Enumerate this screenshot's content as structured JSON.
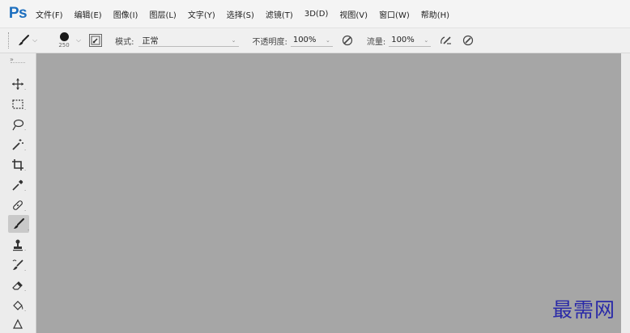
{
  "app": {
    "logo": "Ps",
    "brand_color": "#1d6fbf"
  },
  "menu": [
    {
      "label": "文件(F)"
    },
    {
      "label": "编辑(E)"
    },
    {
      "label": "图像(I)"
    },
    {
      "label": "图层(L)"
    },
    {
      "label": "文字(Y)"
    },
    {
      "label": "选择(S)"
    },
    {
      "label": "滤镜(T)"
    },
    {
      "label": "3D(D)"
    },
    {
      "label": "视图(V)"
    },
    {
      "label": "窗口(W)"
    },
    {
      "label": "帮助(H)"
    }
  ],
  "options": {
    "tool_preset_icon": "brush-icon",
    "brush_size": "250",
    "mode_label": "模式:",
    "mode_value": "正常",
    "opacity_label": "不透明度:",
    "opacity_value": "100%",
    "flow_label": "流量:",
    "flow_value": "100%"
  },
  "toolbar": {
    "tools": [
      {
        "name": "move-tool",
        "icon": "move-icon"
      },
      {
        "name": "marquee-tool",
        "icon": "rectangle-marquee-icon"
      },
      {
        "name": "lasso-tool",
        "icon": "lasso-icon"
      },
      {
        "name": "magic-wand-tool",
        "icon": "magic-wand-icon"
      },
      {
        "name": "crop-tool",
        "icon": "crop-icon"
      },
      {
        "name": "eyedropper-tool",
        "icon": "eyedropper-icon"
      },
      {
        "name": "healing-brush-tool",
        "icon": "bandage-icon"
      },
      {
        "name": "brush-tool",
        "icon": "brush-icon",
        "active": true
      },
      {
        "name": "clone-stamp-tool",
        "icon": "stamp-icon"
      },
      {
        "name": "history-brush-tool",
        "icon": "history-brush-icon"
      },
      {
        "name": "eraser-tool",
        "icon": "eraser-icon"
      },
      {
        "name": "paint-bucket-tool",
        "icon": "bucket-icon"
      },
      {
        "name": "sharpen-tool",
        "icon": "triangle-icon"
      }
    ]
  },
  "canvas": {
    "background": "#a6a6a6"
  },
  "watermark": {
    "text": "最需网",
    "color": "#2a2aa8"
  }
}
